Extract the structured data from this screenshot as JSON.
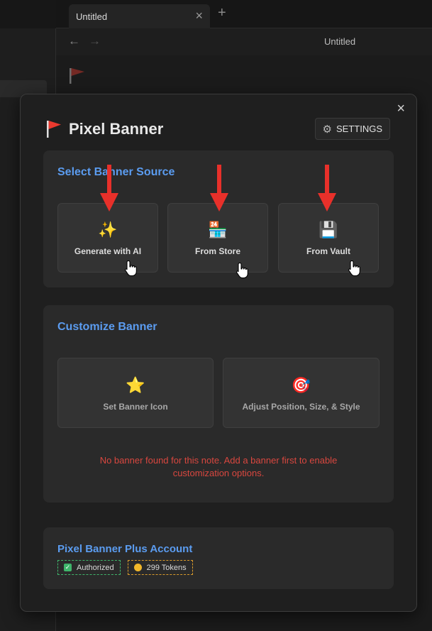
{
  "tab": {
    "title": "Untitled",
    "close_icon": "×",
    "add_icon": "+"
  },
  "nav": {
    "back_icon": "←",
    "forward_icon": "→",
    "title": "Untitled"
  },
  "modal": {
    "close_icon": "×",
    "title": "Pixel Banner",
    "settings_label": "SETTINGS",
    "settings_icon": "⚙"
  },
  "source_section": {
    "title": "Select Banner Source",
    "cards": [
      {
        "emoji": "✨",
        "label": "Generate with AI"
      },
      {
        "emoji": "🏪",
        "label": "From Store"
      },
      {
        "emoji": "💾",
        "label": "From Vault"
      }
    ]
  },
  "customize_section": {
    "title": "Customize Banner",
    "cards": [
      {
        "emoji": "⭐",
        "label": "Set Banner Icon"
      },
      {
        "emoji": "🎯",
        "label": "Adjust Position, Size, & Style"
      }
    ],
    "warning": "No banner found for this note. Add a banner first to enable customization options."
  },
  "account_section": {
    "title": "Pixel Banner Plus Account",
    "authorized_label": "Authorized",
    "tokens_label": "299 Tokens"
  },
  "colors": {
    "accent_blue": "#5b9cf0",
    "warning_red": "#d9473f",
    "arrow_red": "#e8302a",
    "authorized_green": "#3fb56b",
    "token_gold": "#f1b72a"
  }
}
